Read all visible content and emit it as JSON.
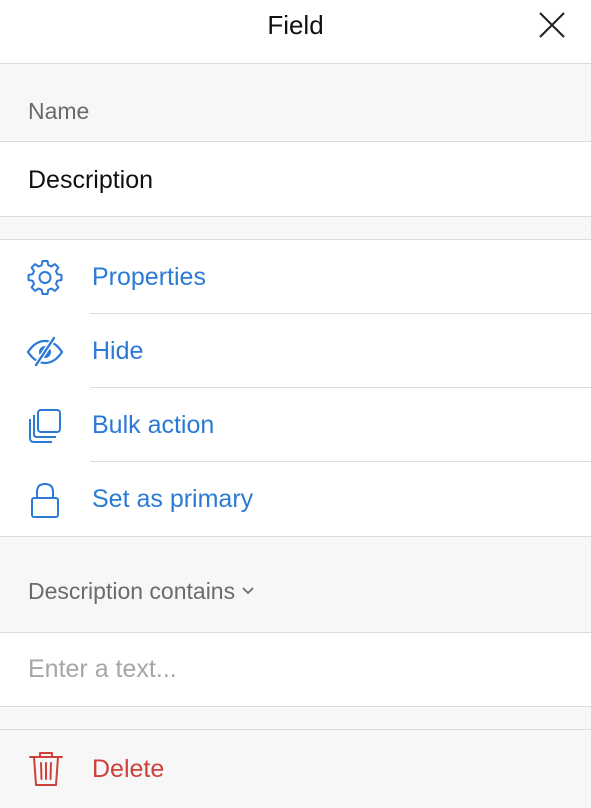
{
  "header": {
    "title": "Field"
  },
  "name_section": {
    "label": "Name",
    "value": "Description"
  },
  "actions": [
    {
      "label": "Properties",
      "icon": "gear-icon"
    },
    {
      "label": "Hide",
      "icon": "eye-slash-icon"
    },
    {
      "label": "Bulk action",
      "icon": "copy-stack-icon"
    },
    {
      "label": "Set as primary",
      "icon": "lock-icon"
    }
  ],
  "filter": {
    "label": "Description contains",
    "placeholder": "Enter a text...",
    "value": ""
  },
  "delete": {
    "label": "Delete",
    "icon": "trash-icon"
  },
  "colors": {
    "accent": "#2a7ad6",
    "danger": "#d0403a",
    "muted_text": "#6b6b6b",
    "background": "#f7f7f7",
    "divider": "#dcdcdc"
  }
}
